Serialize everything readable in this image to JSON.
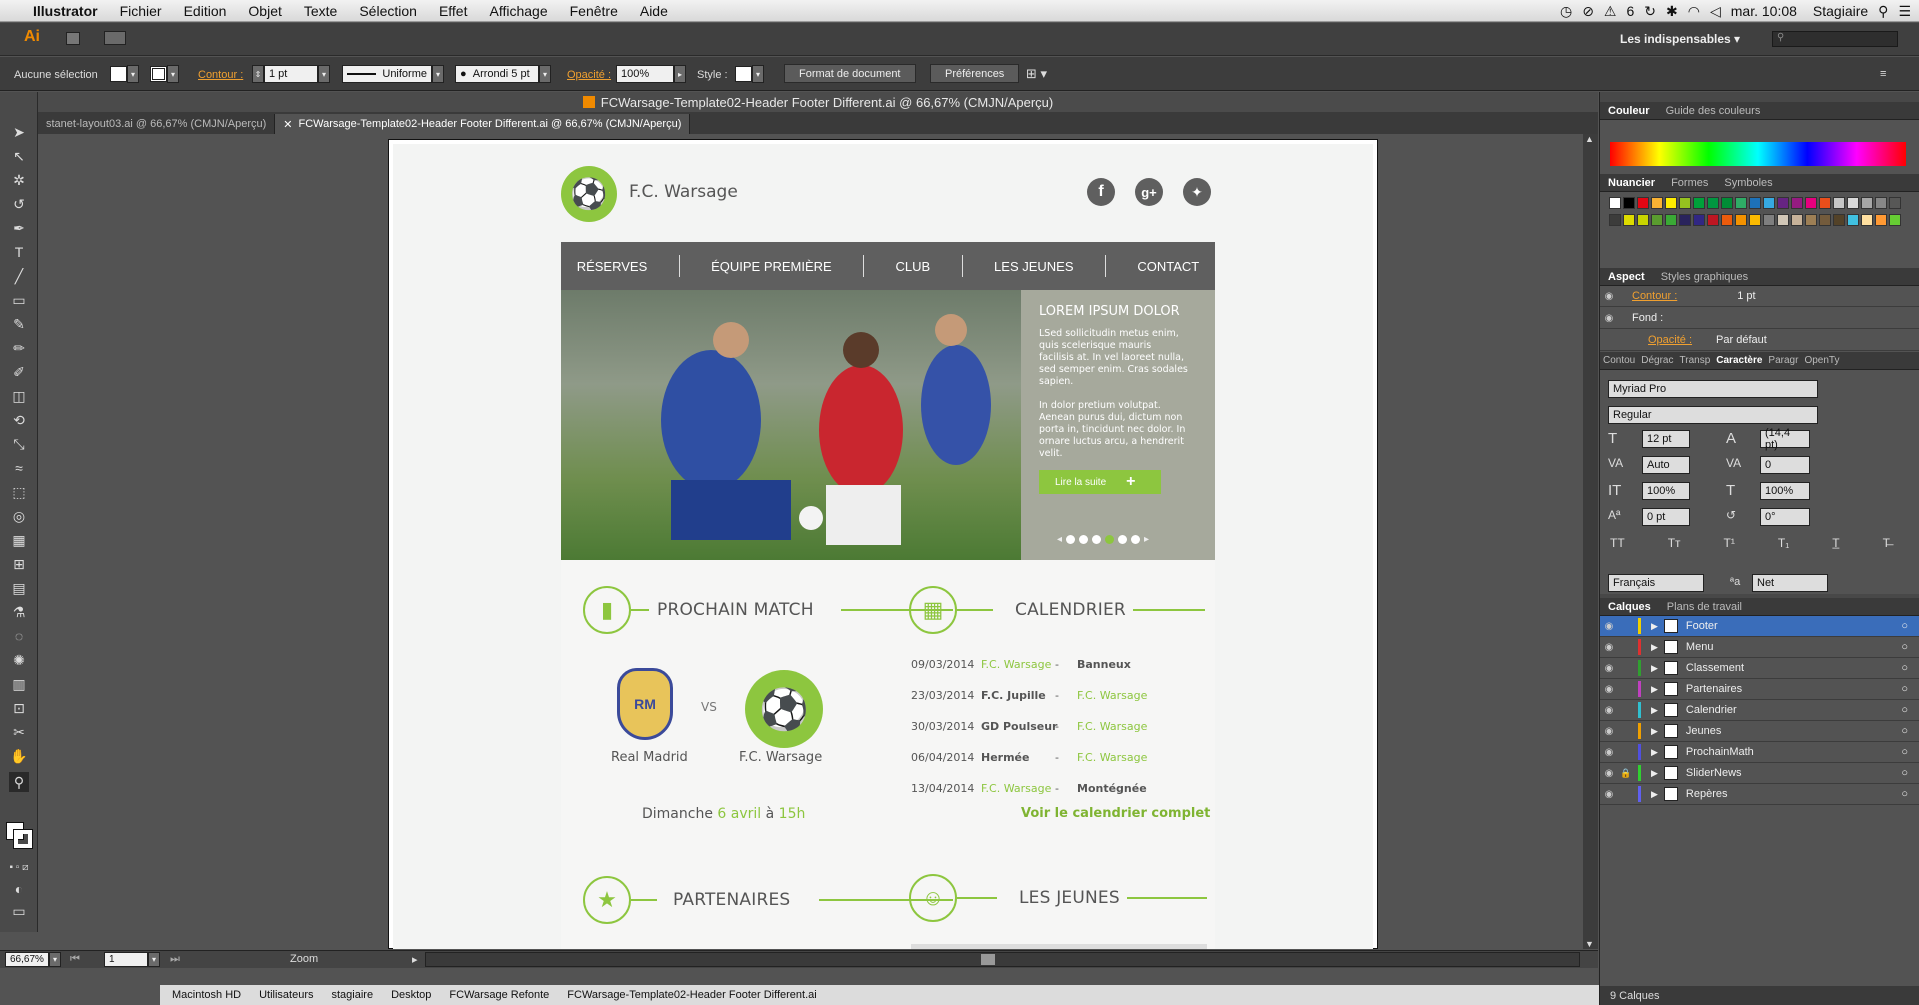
{
  "menubar": {
    "apple": "",
    "app": "Illustrator",
    "items": [
      "Fichier",
      "Edition",
      "Objet",
      "Texte",
      "Sélection",
      "Effet",
      "Affichage",
      "Fenêtre",
      "Aide"
    ],
    "clock": "mar. 10:08",
    "user": "Stagiaire",
    "adobe_count": "6"
  },
  "ctrl": {
    "logo": "Ai",
    "workspace": "Les indispensables",
    "search_placeholder": ""
  },
  "options": {
    "selection": "Aucune sélection",
    "contour_label": "Contour :",
    "stroke_weight": "1 pt",
    "stroke_profile": "Uniforme",
    "brush": "Arrondi 5 pt",
    "opacity_label": "Opacité :",
    "opacity": "100%",
    "style_label": "Style :",
    "doc_format_btn": "Format de document",
    "prefs_btn": "Préférences"
  },
  "document": {
    "title": "FCWarsage-Template02-Header Footer Different.ai @ 66,67% (CMJN/Aperçu)",
    "tabs": [
      "stanet-layout03.ai @ 66,67% (CMJN/Aperçu)",
      "FCWarsage-Template02-Header Footer Different.ai @ 66,67% (CMJN/Aperçu)"
    ]
  },
  "site": {
    "club_name": "F.C. Warsage",
    "nav": [
      "RÉSERVES",
      "ÉQUIPE PREMIÈRE",
      "CLUB",
      "LES JEUNES",
      "CONTACT"
    ],
    "slider": {
      "title": "LOREM IPSUM DOLOR",
      "p1": "LSed sollicitudin metus enim, quis scelerisque mauris facilisis at. In vel laoreet nulla, sed semper enim. Cras sodales sapien.",
      "p2": "In dolor pretium volutpat. Aenean purus dui, dictum non porta in, tincidunt nec dolor. In ornare luctus arcu, a hendrerit velit.",
      "button": "Lire la suite"
    },
    "match": {
      "title": "PROCHAIN MATCH",
      "home": "Real Madrid",
      "vs": "VS",
      "away": "F.C. Warsage",
      "date_prefix": "Dimanche ",
      "date_day": "6 avril",
      "date_mid": " à ",
      "date_time": "15h"
    },
    "calendar": {
      "title": "CALENDRIER",
      "rows": [
        {
          "date": "09/03/2014",
          "home": "F.C. Warsage",
          "sep": "-",
          "away": "Banneux",
          "home_hl": true
        },
        {
          "date": "23/03/2014",
          "home": "F.C. Jupille",
          "sep": "-",
          "away": "F.C. Warsage",
          "home_hl": false
        },
        {
          "date": "30/03/2014",
          "home": "GD Poulseur",
          "sep": "-",
          "away": "F.C. Warsage",
          "home_hl": false
        },
        {
          "date": "06/04/2014",
          "home": "Hermée",
          "sep": "-",
          "away": "F.C. Warsage",
          "home_hl": false
        },
        {
          "date": "13/04/2014",
          "home": "F.C. Warsage",
          "sep": "-",
          "away": "Montégnée",
          "home_hl": true
        }
      ],
      "link": "Voir le calendrier complet"
    },
    "partners": "PARTENAIRES",
    "youth": "LES JEUNES"
  },
  "bottombar": {
    "zoom": "66,67%",
    "page": "1",
    "mode": "Zoom"
  },
  "path": [
    "Macintosh HD",
    "Utilisateurs",
    "stagiaire",
    "Desktop",
    "FCWarsage Refonte",
    "FCWarsage-Template02-Header Footer Different.ai"
  ],
  "panels": {
    "color_tabs": [
      "Couleur",
      "Guide des couleurs"
    ],
    "swatch_tabs": [
      "Nuancier",
      "Formes",
      "Symboles"
    ],
    "aspect_tabs": [
      "Aspect",
      "Styles graphiques"
    ],
    "aspect": {
      "contour": "Contour :",
      "contour_val": "1 pt",
      "fond": "Fond :",
      "opacite": "Opacité :",
      "opacite_val": "Par défaut"
    },
    "char_tabs": [
      "Contou",
      "Dégrac",
      "Transp",
      "Caractère",
      "Paragr",
      "OpenTy"
    ],
    "char": {
      "font": "Myriad Pro",
      "style": "Regular",
      "size": "12 pt",
      "leading": "(14,4 pt)",
      "kerning": "Auto",
      "tracking": "0",
      "hscale": "100%",
      "vscale": "100%",
      "baseline": "0 pt",
      "rotation": "0°",
      "lang": "Français",
      "aa": "Net"
    },
    "layer_tabs": [
      "Calques",
      "Plans de travail"
    ],
    "layers": [
      {
        "name": "Footer",
        "color": "#f0d000"
      },
      {
        "name": "Menu",
        "color": "#e03030"
      },
      {
        "name": "Classement",
        "color": "#30a030"
      },
      {
        "name": "Partenaires",
        "color": "#c040c0"
      },
      {
        "name": "Calendrier",
        "color": "#30c0d0"
      },
      {
        "name": "Jeunes",
        "color": "#f0a000"
      },
      {
        "name": "ProchainMath",
        "color": "#5050e0"
      },
      {
        "name": "SliderNews",
        "color": "#30d030"
      },
      {
        "name": "Repères",
        "color": "#6060f0"
      }
    ],
    "layer_count": "9 Calques"
  },
  "colors": {
    "green": "#8dc63f",
    "nav": "#5f5f5f",
    "slider_bg": "#a6a99c"
  }
}
